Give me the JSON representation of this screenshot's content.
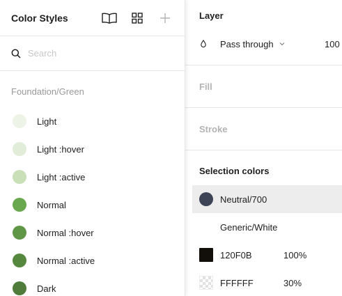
{
  "color_styles_panel": {
    "title": "Color Styles",
    "toolbar_icons": [
      "book-open-icon",
      "grid-icon",
      "plus-icon"
    ],
    "search": {
      "placeholder": "Search",
      "value": ""
    },
    "group_name": "Foundation/Green",
    "styles": [
      {
        "name": "Light",
        "color": "#eef3e8"
      },
      {
        "name": "Light :hover",
        "color": "#e2edd9"
      },
      {
        "name": "Light :active",
        "color": "#c9dfb8"
      },
      {
        "name": "Normal",
        "color": "#6aa84f"
      },
      {
        "name": "Normal :hover",
        "color": "#5f9747"
      },
      {
        "name": "Normal :active",
        "color": "#56873f"
      },
      {
        "name": "Dark",
        "color": "#4f7c3b"
      }
    ]
  },
  "properties_panel": {
    "layer": {
      "title": "Layer",
      "blend_mode": "Pass through",
      "opacity": "100"
    },
    "fill": {
      "title": "Fill"
    },
    "stroke": {
      "title": "Stroke"
    },
    "selection_colors": {
      "title": "Selection colors",
      "items": [
        {
          "name": "Neutral/700",
          "opacity": "",
          "color": "#3c4456",
          "shape": "round"
        },
        {
          "name": "Generic/White",
          "opacity": "",
          "color": "",
          "shape": "blank"
        },
        {
          "name": "120F0B",
          "opacity": "100%",
          "color": "#120f0b",
          "shape": "square"
        },
        {
          "name": "FFFFFF",
          "opacity": "30%",
          "color": "#ffffff",
          "shape": "checker"
        }
      ]
    }
  }
}
